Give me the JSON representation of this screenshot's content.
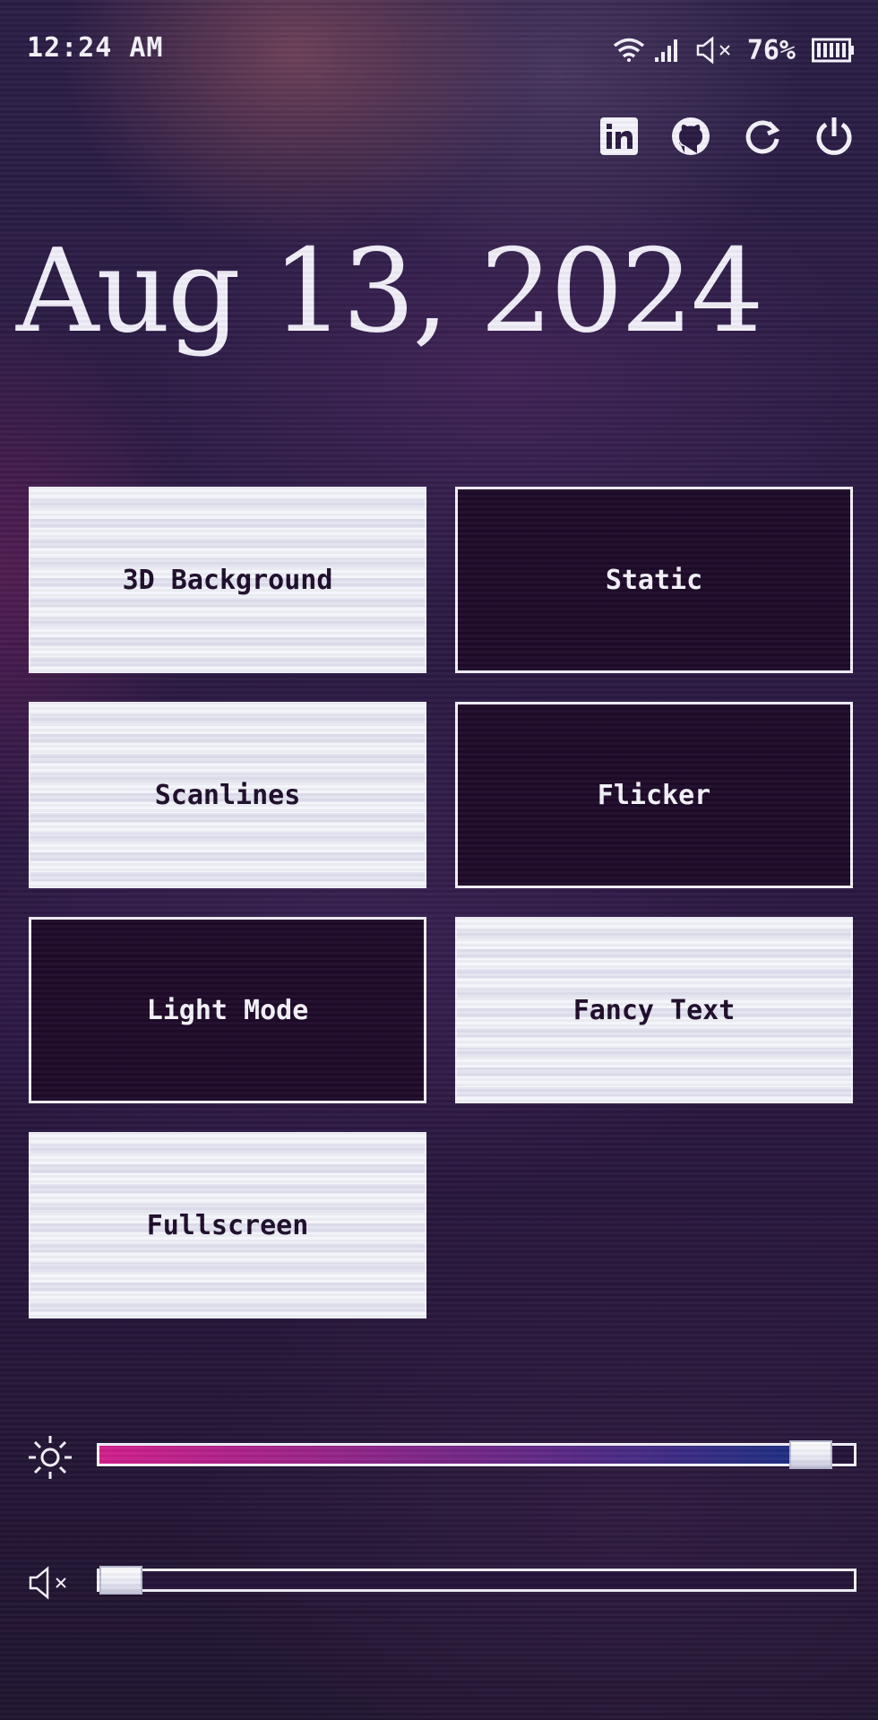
{
  "status_bar": {
    "time": "12:24 AM",
    "battery_percent": "76%",
    "icons": [
      "wifi-icon",
      "signal-icon",
      "muted-speaker-icon",
      "battery-icon"
    ]
  },
  "top_actions": [
    "linkedin-icon",
    "github-icon",
    "refresh-icon",
    "power-icon"
  ],
  "date": "Aug 13, 2024",
  "toggles": [
    {
      "label": "3D Background",
      "state": "on"
    },
    {
      "label": "Static",
      "state": "off"
    },
    {
      "label": "Scanlines",
      "state": "on"
    },
    {
      "label": "Flicker",
      "state": "off"
    },
    {
      "label": "Light Mode",
      "state": "off"
    },
    {
      "label": "Fancy Text",
      "state": "on"
    },
    {
      "label": "Fullscreen",
      "state": "on"
    }
  ],
  "sliders": {
    "brightness": {
      "icon": "sun-icon",
      "value": 0.97,
      "gradient_start": "#d21f8c",
      "gradient_end": "#1a2f82"
    },
    "volume": {
      "icon": "muted-speaker-icon",
      "value": 0.0
    }
  },
  "colors": {
    "button_on_bg": "#f4f4fb",
    "button_off_bg": "#1e0a29",
    "button_on_text": "#1d0c2a",
    "text": "#f0eef8"
  }
}
